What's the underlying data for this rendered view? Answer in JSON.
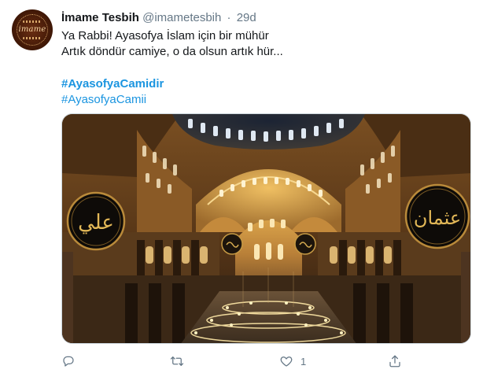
{
  "tweet": {
    "avatar_label": "imame",
    "display_name": "İmame Tesbih",
    "handle": "@imametesbih",
    "separator": "·",
    "time": "29d",
    "text_lines": [
      "Ya Rabbi! Ayasofya İslam için bir mühür",
      "Artık döndür camiye, o da olsun artık hür..."
    ],
    "hashtags": [
      "#AyasofyaCamidir",
      "#AyasofyaCamii"
    ],
    "media": {
      "calligraphy_left": "علي",
      "calligraphy_right": "عثمان"
    },
    "actions": {
      "reply": {
        "icon": "reply-icon",
        "count": ""
      },
      "retweet": {
        "icon": "retweet-icon",
        "count": ""
      },
      "like": {
        "icon": "like-icon",
        "count": "1"
      },
      "share": {
        "icon": "share-icon",
        "count": ""
      }
    }
  },
  "colors": {
    "link": "#1b95e0",
    "secondary_text": "#657786",
    "primary_text": "#14171a",
    "border": "#ccd6dd"
  }
}
